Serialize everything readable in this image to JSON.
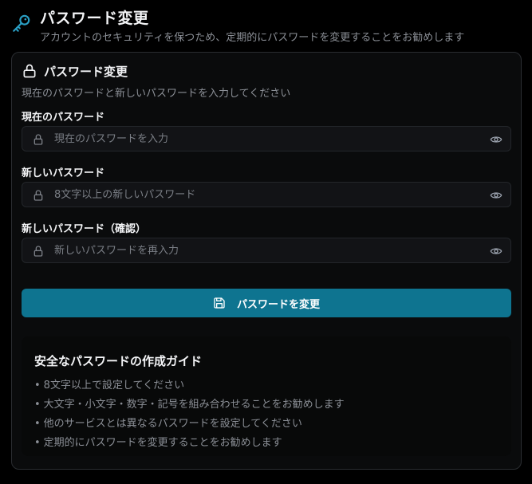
{
  "header": {
    "icon": "key-icon",
    "title": "パスワード変更",
    "subtitle": "アカウントのセキュリティを保つため、定期的にパスワードを変更することをお勧めします"
  },
  "card": {
    "icon": "lock-icon",
    "title": "パスワード変更",
    "description": "現在のパスワードと新しいパスワードを入力してください"
  },
  "form": {
    "current": {
      "label": "現在のパスワード",
      "placeholder": "現在のパスワードを入力",
      "value": ""
    },
    "new": {
      "label": "新しいパスワード",
      "placeholder": "8文字以上の新しいパスワード",
      "value": ""
    },
    "confirm": {
      "label": "新しいパスワード（確認）",
      "placeholder": "新しいパスワードを再入力",
      "value": ""
    },
    "submit_label": "パスワードを変更"
  },
  "guide": {
    "title": "安全なパスワードの作成ガイド",
    "items": [
      "8文字以上で設定してください",
      "大文字・小文字・数字・記号を組み合わせることをお勧めします",
      "他のサービスとは異なるパスワードを設定してください",
      "定期的にパスワードを変更することをお勧めします"
    ]
  },
  "colors": {
    "background": "#000000",
    "card": "#0a0b0c",
    "accent": "#0e7490",
    "key_icon": "#2a9fc4",
    "muted_text": "#8b8f96"
  }
}
